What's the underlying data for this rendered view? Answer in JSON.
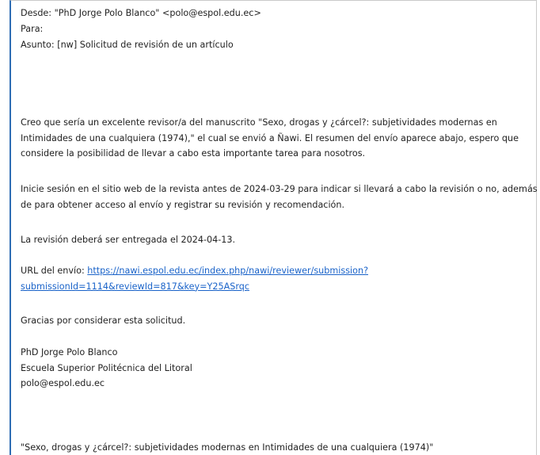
{
  "email": {
    "headers": {
      "from": "Desde: \"PhD Jorge Polo Blanco\" <polo@espol.edu.ec>",
      "to": "Para:",
      "subject": "Asunto: [nw] Solicitud de revisión de un artículo"
    },
    "body": {
      "intro": [
        "Creo que sería un excelente revisor/a del manuscrito \"Sexo, drogas y ¿cárcel?: subjetividades modernas en",
        "Intimidades de una cualquiera (1974),\" el cual se envió a Ñawi. El resumen del envío aparece abajo, espero que",
        "considere la posibilidad de llevar a cabo esta importante tarea para nosotros."
      ],
      "login": [
        "Inicie sesión en el sitio web de la revista antes de 2024-03-29 para indicar si llevará a cabo la revisión o no, además",
        "de para obtener acceso al envío y registrar su revisión y recomendación."
      ],
      "due": "La revisión deberá ser entregada el 2024-04-13.",
      "url_label": "URL del envío: ",
      "url_line1": "https://nawi.espol.edu.ec/index.php/nawi/reviewer/submission?",
      "url_line2": "submissionId=1114&reviewId=817&key=Y25ASrqc",
      "thanks": "Gracias por considerar esta solicitud.",
      "signature": {
        "name": "PhD Jorge Polo Blanco",
        "institution": "Escuela Superior Politécnica del Litoral",
        "email": "polo@espol.edu.ec"
      },
      "title_quote": "\"Sexo, drogas y ¿cárcel?: subjetividades modernas en Intimidades de una cualquiera (1974)\""
    }
  }
}
